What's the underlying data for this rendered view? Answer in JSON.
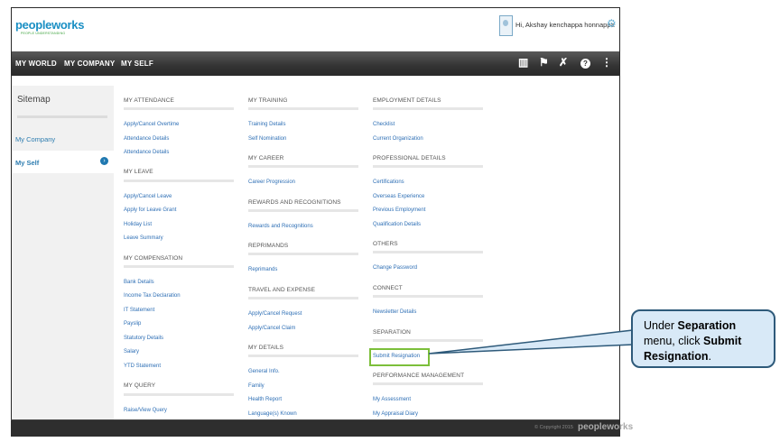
{
  "header": {
    "logo": "peopleworks",
    "logo_tagline": "PEOPLE UNDERSTANDING",
    "greeting": "Hi, Akshay kenchappa honnappa"
  },
  "nav": {
    "items": [
      "MY WORLD",
      "MY COMPANY",
      "MY SELF"
    ],
    "icons": [
      "book-icon",
      "flag-icon",
      "tools-icon",
      "help-icon",
      "share-icon"
    ]
  },
  "sidebar": {
    "title": "Sitemap",
    "items": [
      "My Company",
      "My Self"
    ],
    "active": "My Self"
  },
  "col1": {
    "attendance": {
      "title": "MY ATTENDANCE",
      "links": [
        "Apply/Cancel Overtime",
        "Attendance Details",
        "Attendance Details"
      ]
    },
    "leave": {
      "title": "MY LEAVE",
      "links": [
        "Apply/Cancel Leave",
        "Apply for Leave Grant",
        "Holiday List",
        "Leave Summary"
      ]
    },
    "compensation": {
      "title": "MY COMPENSATION",
      "links": [
        "Bank Details",
        "Income Tax Declaration",
        "IT Statement",
        "Payslip",
        "Statutory Details",
        "Salary",
        "YTD Statement"
      ]
    },
    "query": {
      "title": "MY QUERY",
      "links": [
        "Raise/View Query"
      ]
    }
  },
  "col2": {
    "training": {
      "title": "MY TRAINING",
      "links": [
        "Training Details",
        "Self Nomination"
      ]
    },
    "career": {
      "title": "MY CAREER",
      "links": [
        "Career Progression"
      ]
    },
    "rewards": {
      "title": "REWARDS AND RECOGNITIONS",
      "links": [
        "Rewards and Recognitions"
      ]
    },
    "reprimands": {
      "title": "REPRIMANDS",
      "links": [
        "Reprimands"
      ]
    },
    "travel": {
      "title": "TRAVEL AND EXPENSE",
      "links": [
        "Apply/Cancel Request",
        "Apply/Cancel Claim"
      ]
    },
    "details": {
      "title": "MY DETAILS",
      "links": [
        "General Info.",
        "Family",
        "Health Report",
        "Language(s) Known"
      ]
    }
  },
  "col3": {
    "employment": {
      "title": "EMPLOYMENT DETAILS",
      "links": [
        "Checklist",
        "Current Organization"
      ]
    },
    "professional": {
      "title": "PROFESSIONAL DETAILS",
      "links": [
        "Certifications",
        "Overseas Experience",
        "Previous Employment",
        "Qualification Details"
      ]
    },
    "others": {
      "title": "OTHERS",
      "links": [
        "Change Password"
      ]
    },
    "connect": {
      "title": "CONNECT",
      "links": [
        "Newsletter Details"
      ]
    },
    "separation": {
      "title": "SEPARATION",
      "links": [
        "Submit Resignation"
      ]
    },
    "performance": {
      "title": "PERFORMANCE MANAGEMENT",
      "links": [
        "My Assessment",
        "My Appraisal Diary"
      ]
    }
  },
  "footer": {
    "copyright": "© Copyright 2015",
    "logo": "peopleworks"
  },
  "callout": {
    "pre1": "Under ",
    "bold1": "Separation",
    "pre2": " menu, click ",
    "bold2": "Submit Resignation",
    "post": "."
  },
  "colors": {
    "accent": "#1a8fc4",
    "nav_bg": "#333333",
    "link": "#2e6fb5",
    "highlight": "#7cbf3a",
    "callout_bg": "#d8e9f7"
  }
}
